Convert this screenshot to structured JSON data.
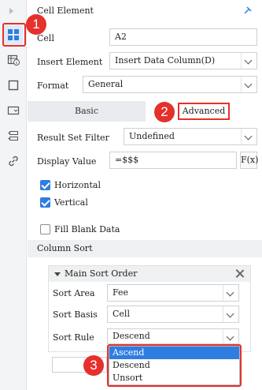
{
  "rail": {
    "icons": [
      "cell-element-icon",
      "cell-attribute-icon",
      "border-icon",
      "widget-icon",
      "condition-icon",
      "hyperlink-icon"
    ]
  },
  "header": {
    "title": "Cell Element"
  },
  "form": {
    "cell_label": "Cell",
    "cell_value": "A2",
    "insert_label": "Insert Element",
    "insert_value": "Insert Data Column(D)",
    "format_label": "Format",
    "format_value": "General"
  },
  "tabs": {
    "basic": "Basic",
    "advanced": "Advanced"
  },
  "advanced": {
    "result_filter_label": "Result Set Filter",
    "result_filter_value": "Undefined",
    "display_label": "Display Value",
    "display_value": "=$$$",
    "fx_label": "F(x)",
    "horizontal_label": "Horizontal",
    "vertical_label": "Vertical",
    "fill_blank_label": "Fill Blank Data",
    "column_sort_label": "Column Sort"
  },
  "sort": {
    "title": "Main Sort Order",
    "area_label": "Sort Area",
    "area_value": "Fee",
    "basis_label": "Sort Basis",
    "basis_value": "Cell",
    "rule_label": "Sort Rule",
    "rule_value": "Descend",
    "options": [
      "Ascend",
      "Descend",
      "Unsort"
    ]
  },
  "annotations": {
    "one": "1",
    "two": "2",
    "three": "3"
  },
  "colors": {
    "accent": "#2f7de1",
    "callout": "#e5302c"
  }
}
